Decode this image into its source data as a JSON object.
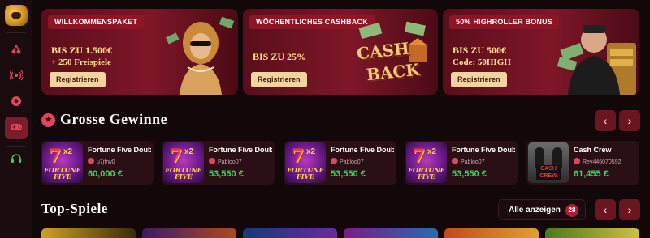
{
  "sidebar": {
    "logo": "casino-logo",
    "items": [
      {
        "icon": "cherry-icon"
      },
      {
        "icon": "live-broadcast-icon"
      },
      {
        "icon": "soccer-ball-icon"
      },
      {
        "icon": "gamepad-icon",
        "active": true
      },
      {
        "icon": "headset-support-icon"
      }
    ]
  },
  "banners": [
    {
      "tag": "WILLKOMMENSPAKET",
      "line1": "BIS ZU 1.500€",
      "line2": "+ 250 Freispiele",
      "button": "Registrieren"
    },
    {
      "tag": "WÖCHENTLICHES CASHBACK",
      "line1": "BIS ZU 25%",
      "line2": "",
      "button": "Registrieren",
      "art_text": [
        "CASH",
        "BACK"
      ]
    },
    {
      "tag": "50% HIGHROLLER BONUS",
      "line1": "BIS ZU 500€",
      "line2": "Code: 50HIGH",
      "button": "Registrieren"
    }
  ],
  "big_wins": {
    "title": "Grosse Gewinne",
    "cards": [
      {
        "game": "Fortune Five Double",
        "user": "u7jfrw0",
        "amount": "60,000 €",
        "thumb_text": [
          "7",
          "x2",
          "FORTUNE FIVE"
        ]
      },
      {
        "game": "Fortune Five Double",
        "user": "Pabloo07",
        "amount": "53,550 €",
        "thumb_text": [
          "7",
          "x2",
          "FORTUNE FIVE"
        ]
      },
      {
        "game": "Fortune Five Double",
        "user": "Pabloo07",
        "amount": "53,550 €",
        "thumb_text": [
          "7",
          "x2",
          "FORTUNE FIVE"
        ]
      },
      {
        "game": "Fortune Five Double",
        "user": "Pabloo07",
        "amount": "53,550 €",
        "thumb_text": [
          "7",
          "x2",
          "FORTUNE FIVE"
        ]
      },
      {
        "game": "Cash Crew",
        "user": "Rev446070592",
        "amount": "61,455 €",
        "thumb_text": [
          "CASH CREW"
        ]
      }
    ]
  },
  "top_games": {
    "title": "Top-Spiele",
    "all_label": "Alle anzeigen",
    "count": "28"
  },
  "colors": {
    "accent": "#e0465c",
    "win_green": "#3fd15c",
    "banner_gold": "#ffe58a"
  }
}
